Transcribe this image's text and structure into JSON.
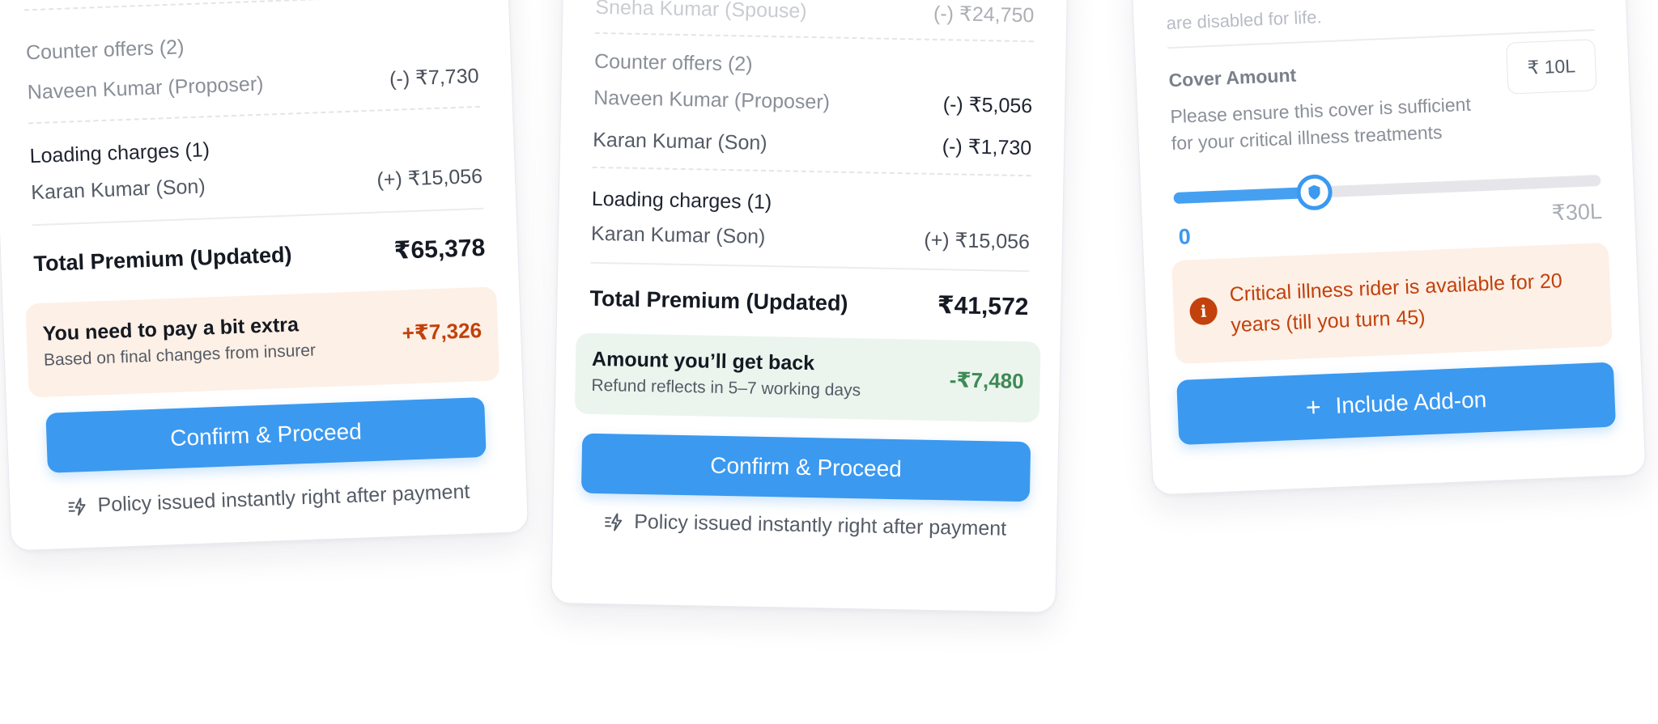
{
  "left_card": {
    "counter_offers_label": "Counter offers (2)",
    "counter_rows": [
      {
        "name": "Naveen Kumar (Proposer)",
        "amount": "(-) ₹7,730"
      }
    ],
    "loading_label": "Loading charges (1)",
    "loading_rows": [
      {
        "name": "Karan Kumar (Son)",
        "amount": "(+) ₹15,056"
      }
    ],
    "total_label": "Total Premium (Updated)",
    "total_amount": "₹65,378",
    "notice": {
      "title": "You need to pay a bit extra",
      "subtitle": "Based on final changes from insurer",
      "amount": "+₹7,326",
      "bg": "#fdf0e6",
      "amount_color": "#c2410c"
    },
    "button_label": "Confirm & Proceed",
    "footnote": "Policy issued instantly right after payment"
  },
  "middle_card": {
    "top_partial_name": "Sneha Kumar (Spouse)",
    "top_partial_amount": "(-) ₹24,750",
    "counter_offers_label": "Counter offers (2)",
    "counter_rows": [
      {
        "name": "Naveen Kumar (Proposer)",
        "amount": "(-) ₹5,056"
      },
      {
        "name": "Karan Kumar (Son)",
        "amount": "(-) ₹1,730"
      }
    ],
    "loading_label": "Loading charges (1)",
    "loading_rows": [
      {
        "name": "Karan Kumar (Son)",
        "amount": "(+) ₹15,056"
      }
    ],
    "total_label": "Total Premium (Updated)",
    "total_amount": "₹41,572",
    "notice": {
      "title": "Amount you’ll get back",
      "subtitle": "Refund reflects in 5–7 working days",
      "amount": "-₹7,480",
      "bg": "#ebf5ee",
      "amount_color": "#3f8a55"
    },
    "button_label": "Confirm & Proceed",
    "footnote": "Policy issued instantly right after payment"
  },
  "right_card": {
    "top_partial_text": "are disabled for life.",
    "cover_title": "Cover Amount",
    "cover_value": "₹ 10L",
    "cover_help": "Please ensure this cover is sufficient for your critical illness treatments",
    "slider": {
      "min_label": "0",
      "max_label": "₹30L",
      "value_fraction": 0.33
    },
    "notice_text": "Critical illness rider is available for 20 years (till you turn 45)",
    "notice_bg": "#fdf0e6",
    "notice_color": "#c2410c",
    "button_label": "Include Add-on",
    "button_icon": "plus-icon"
  },
  "colors": {
    "accent": "#3b99f0",
    "warning": "#c2410c",
    "success": "#3f8a55"
  }
}
